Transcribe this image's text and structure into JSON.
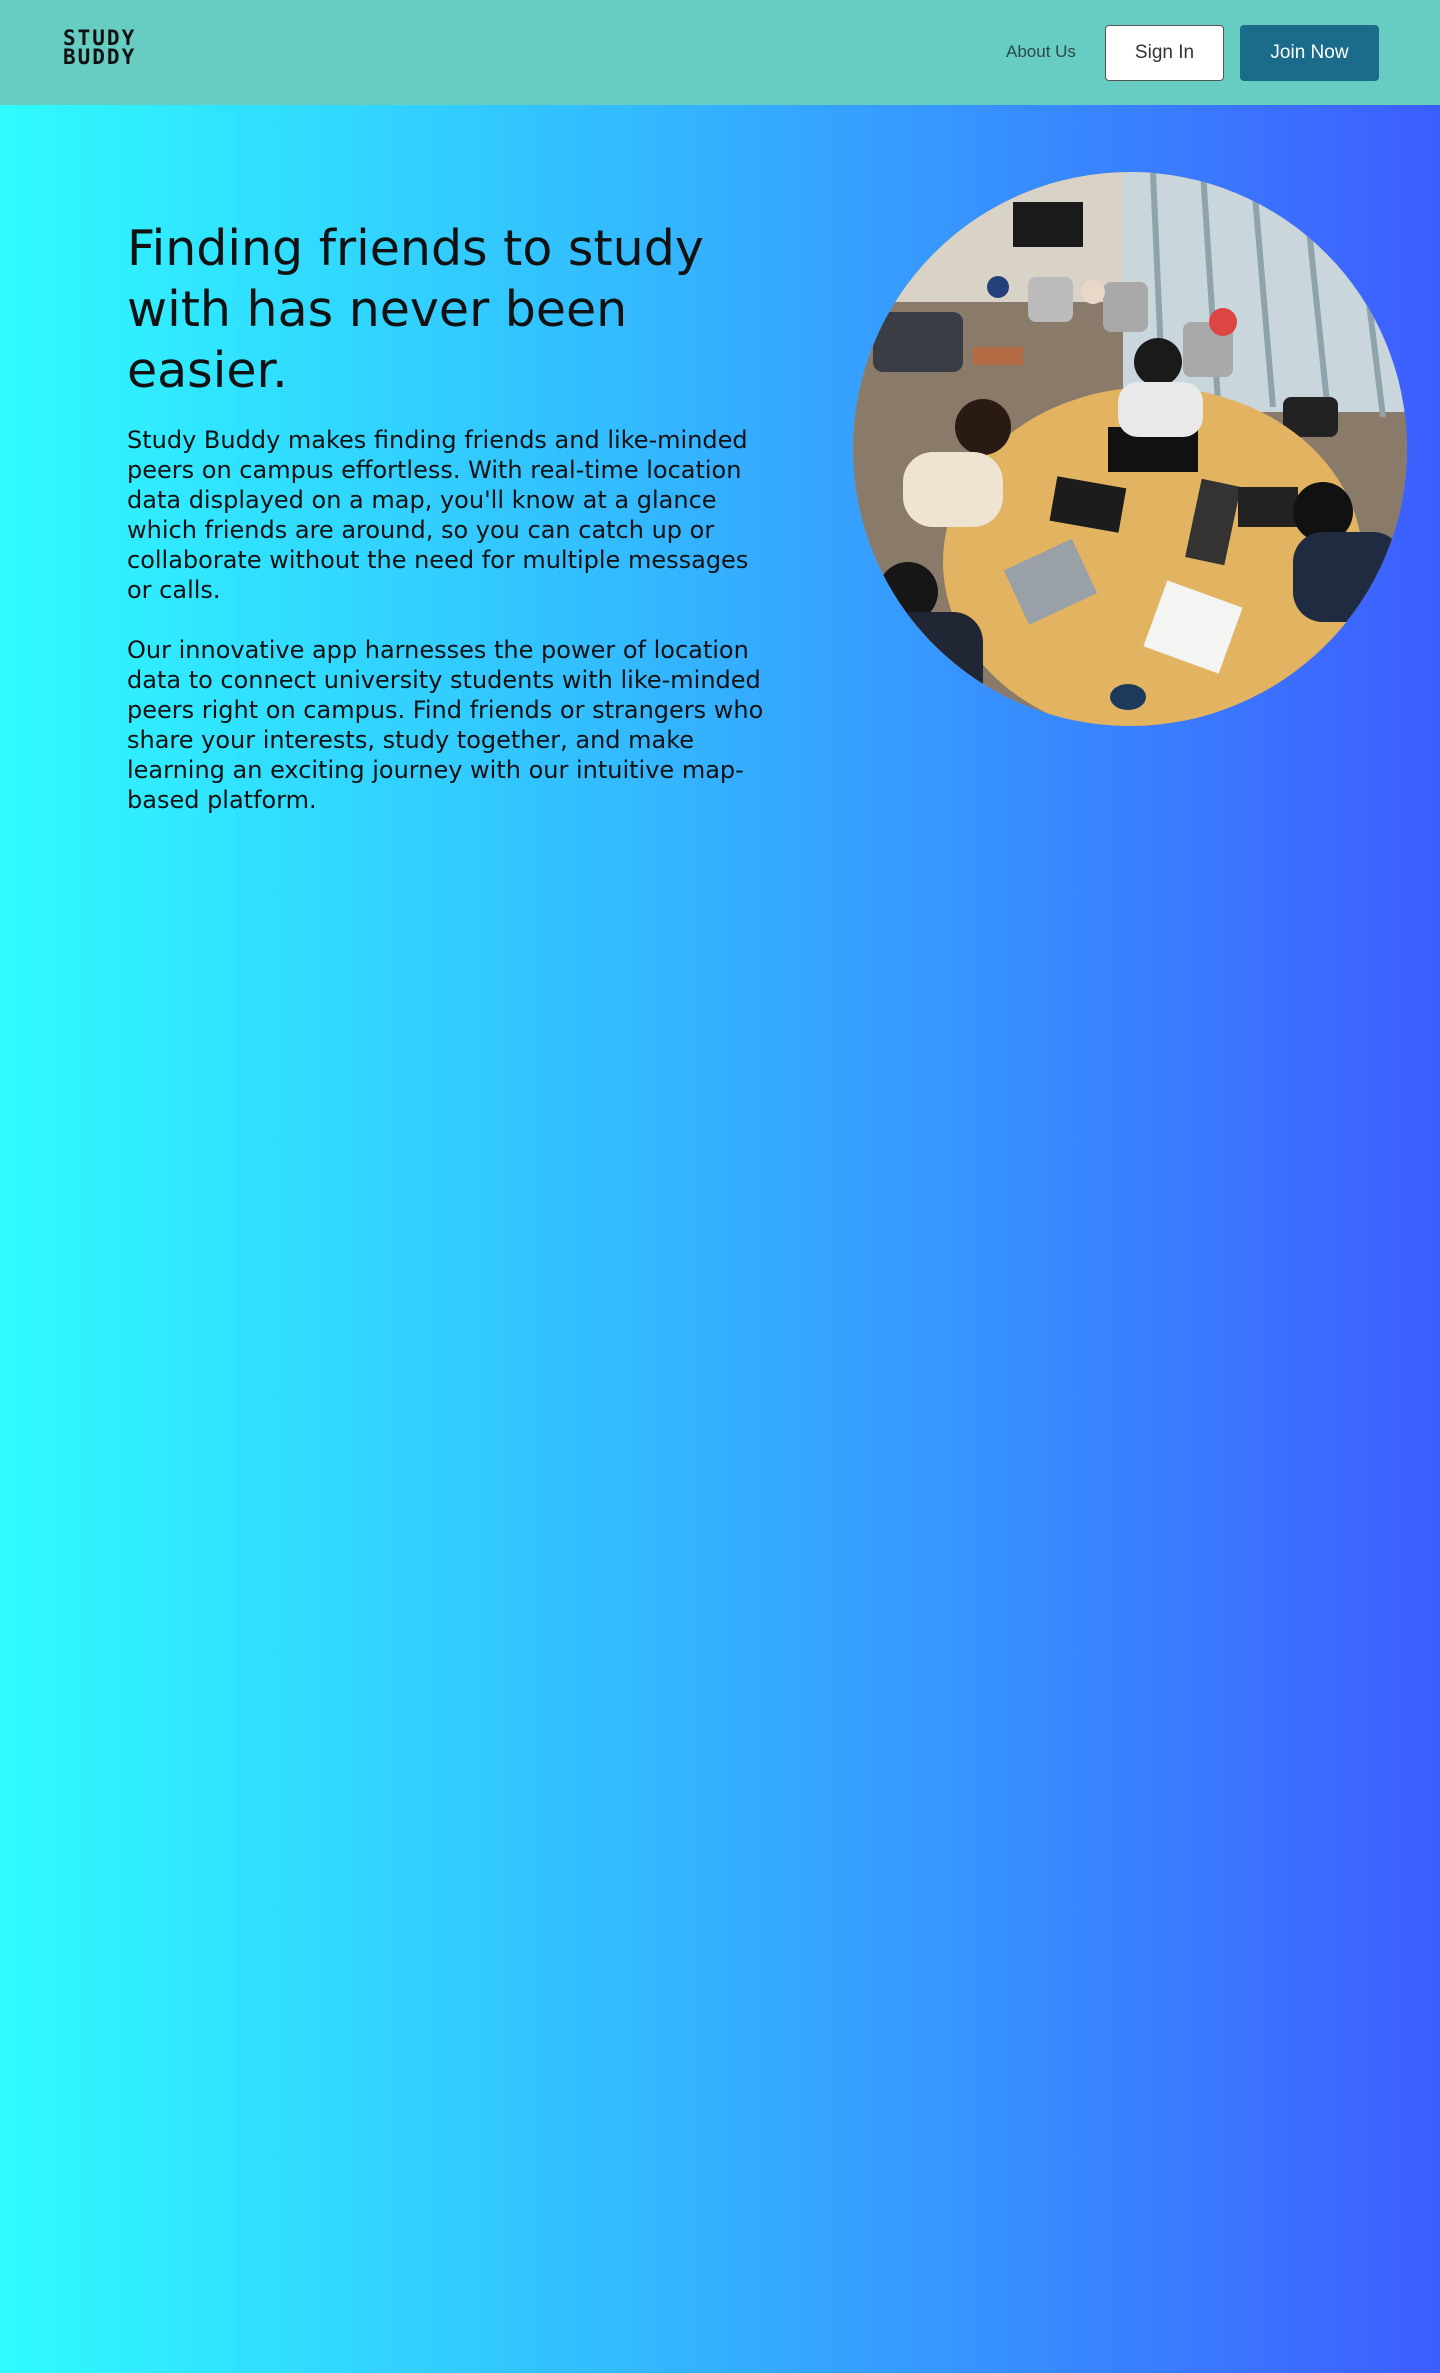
{
  "nav": {
    "logo_line1": "STUDY",
    "logo_line2": "BUDDY",
    "about_label": "About Us",
    "signin_label": "Sign In",
    "join_label": "Join Now"
  },
  "hero": {
    "headline": "Finding friends to study with has never been easier.",
    "paragraph1": "Study Buddy makes finding friends and like-minded peers on campus effortless. With real-time location data displayed on a map, you'll know at a glance which friends are around, so you can catch up or collaborate without the need for multiple messages or calls.",
    "paragraph2": "Our innovative app harnesses the power of location data to connect university students with like-minded peers right on campus. Find friends or strangers who share your interests, study together, and make learning an exciting journey with our intuitive map-based platform."
  },
  "colors": {
    "navbar": "#67cdc2",
    "gradient_start": "#2ffbff",
    "gradient_end": "#3d5dff",
    "join_button": "#1b6b8a"
  }
}
